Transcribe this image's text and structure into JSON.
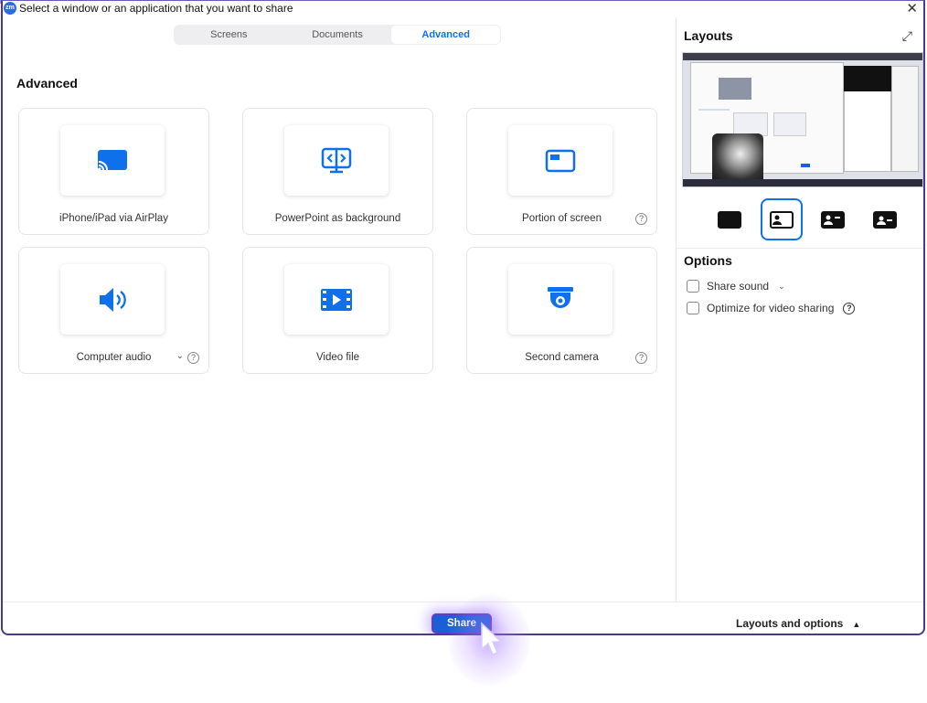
{
  "window": {
    "title": "Select a window or an application that you want to share",
    "app_icon_text": "zm"
  },
  "tabs": [
    {
      "label": "Screens",
      "active": false
    },
    {
      "label": "Documents",
      "active": false
    },
    {
      "label": "Advanced",
      "active": true
    }
  ],
  "section_title": "Advanced",
  "cards": [
    {
      "label": "iPhone/iPad via AirPlay",
      "icon": "airplay-icon",
      "help": false,
      "dropdown": false
    },
    {
      "label": "PowerPoint as background",
      "icon": "powerpoint-background-icon",
      "help": false,
      "dropdown": false
    },
    {
      "label": "Portion of screen",
      "icon": "screen-portion-icon",
      "help": true,
      "dropdown": false
    },
    {
      "label": "Computer audio",
      "icon": "speaker-icon",
      "help": true,
      "dropdown": true
    },
    {
      "label": "Video file",
      "icon": "video-file-icon",
      "help": false,
      "dropdown": false
    },
    {
      "label": "Second camera",
      "icon": "camera-icon",
      "help": true,
      "dropdown": false
    }
  ],
  "help_glyph": "?",
  "chevron_glyph": "⌄",
  "right_panel": {
    "layouts_title": "Layouts",
    "options_title": "Options",
    "options": [
      {
        "label": "Share sound",
        "checked": false,
        "dropdown": true,
        "help": false
      },
      {
        "label": "Optimize for video sharing",
        "checked": false,
        "dropdown": false,
        "help": true
      }
    ],
    "layout_buttons": [
      "screen-only",
      "screen-with-presenter-left",
      "presenter-card-left",
      "presenter-card-center"
    ],
    "selected_layout": "screen-with-presenter-left"
  },
  "footer": {
    "share_label": "Share",
    "layouts_options_label": "Layouts and options",
    "layouts_options_arrow": "▲"
  },
  "colors": {
    "accent": "#0e71eb",
    "share_button": "#1a5fd6",
    "window_border": "#4a3a8c",
    "glow": "#a06eff"
  }
}
